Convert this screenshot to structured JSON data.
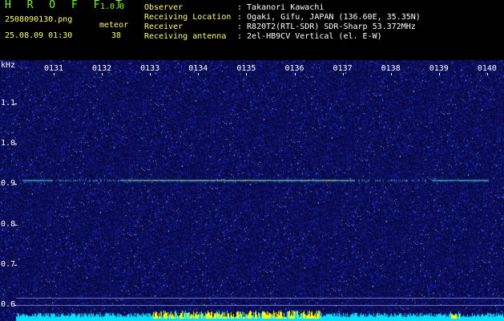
{
  "header": {
    "app_name": "H R O F F T",
    "app_version": "1.0.0",
    "file_name": "2508090130.png",
    "datetime": "25.08.09 01:30",
    "meteor_label": "meteor",
    "meteor_count": "38",
    "info": [
      {
        "key": "Observer",
        "value": ": Takanori Kawachi"
      },
      {
        "key": "Receiving Location",
        "value": ": Ogaki, Gifu, JAPAN (136.60E, 35.35N)"
      },
      {
        "key": "Receiver",
        "value": ": R820T2(RTL-SDR) SDR-Sharp 53.372MHz"
      },
      {
        "key": "Receiving antenna",
        "value": ": 2el-HB9CV Vertical (el. E-W)"
      }
    ]
  },
  "colors": {
    "header_bg": "#000000",
    "spectro_bg": "#08093a",
    "app_name": "#7CFC00",
    "info_key": "#ffff66",
    "info_value": "#ffffff",
    "signal": "#4fe0d0",
    "signal_hot": "#d6ff66",
    "level_bar": "#00e0ff",
    "level_peak": "#ffff00"
  },
  "chart_data": {
    "type": "heatmap",
    "y_unit": "kHz",
    "x_ticks": [
      "0131",
      "0132",
      "0133",
      "0134",
      "0135",
      "0136",
      "0137",
      "0138",
      "0139",
      "0140"
    ],
    "y_ticks": [
      "1.1",
      "1.0",
      "0.9",
      "0.8",
      "0.7",
      "0.6"
    ],
    "ylim": [
      0.58,
      1.18
    ],
    "carrier_khz": 0.91
  }
}
